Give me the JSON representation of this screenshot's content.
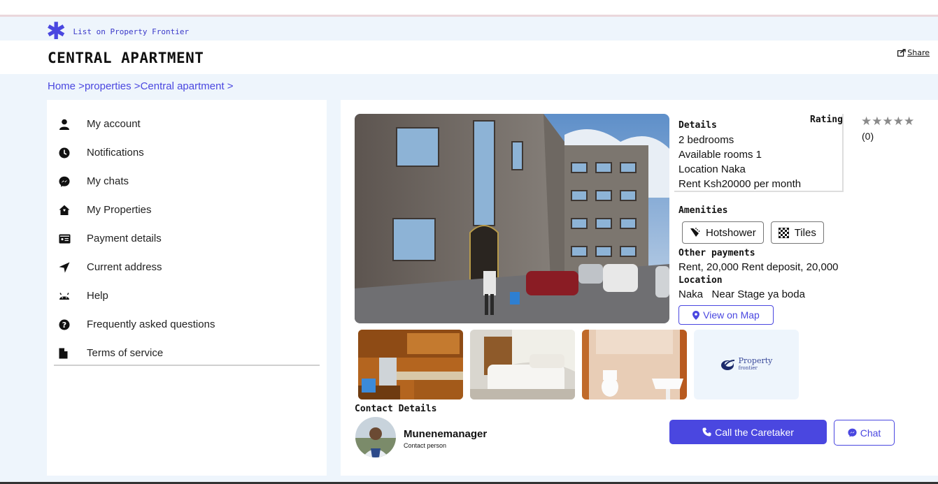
{
  "top": {
    "list_link": "List on Property Frontier"
  },
  "header": {
    "title": "CENTRAL APARTMENT",
    "share_label": "Share"
  },
  "breadcrumb": "Home >properties >Central apartment >",
  "sidebar": {
    "items": [
      {
        "label": "My account",
        "icon": "user-icon"
      },
      {
        "label": "Notifications",
        "icon": "clock-icon"
      },
      {
        "label": "My chats",
        "icon": "messenger-icon"
      },
      {
        "label": "My Properties",
        "icon": "house-icon"
      },
      {
        "label": "Payment details",
        "icon": "id-card-icon"
      },
      {
        "label": "Current address",
        "icon": "location-arrow-icon"
      },
      {
        "label": "Help",
        "icon": "android-icon"
      },
      {
        "label": "Frequently asked questions",
        "icon": "question-circle-icon"
      },
      {
        "label": "Terms of service",
        "icon": "file-icon"
      }
    ]
  },
  "property": {
    "details_heading": "Details",
    "bedrooms": "2 bedrooms",
    "available_rooms": "Available rooms 1",
    "location_line": "Location Naka",
    "rent_line": "Rent Ksh20000 per month",
    "rating_label": "Rating",
    "rating_value": 0,
    "rating_count": "(0)",
    "amenities_heading": "Amenities",
    "amenities": [
      "Hotshower",
      "Tiles"
    ],
    "other_payments_heading": "Other payments",
    "other_payments": "Rent, 20,000 Rent deposit, 20,000",
    "location_heading": "Location",
    "location_value": "Naka   Near Stage ya boda",
    "map_button": "View on Map",
    "logo_text_1": "Property",
    "logo_text_2": "frontier"
  },
  "contact": {
    "heading": "Contact Details",
    "name": "Munenemanager",
    "role": "Contact person",
    "call_button": "Call the Caretaker",
    "chat_button": "Chat"
  },
  "colors": {
    "accent": "#4a47e0",
    "page_bg": "#eef5fc"
  }
}
